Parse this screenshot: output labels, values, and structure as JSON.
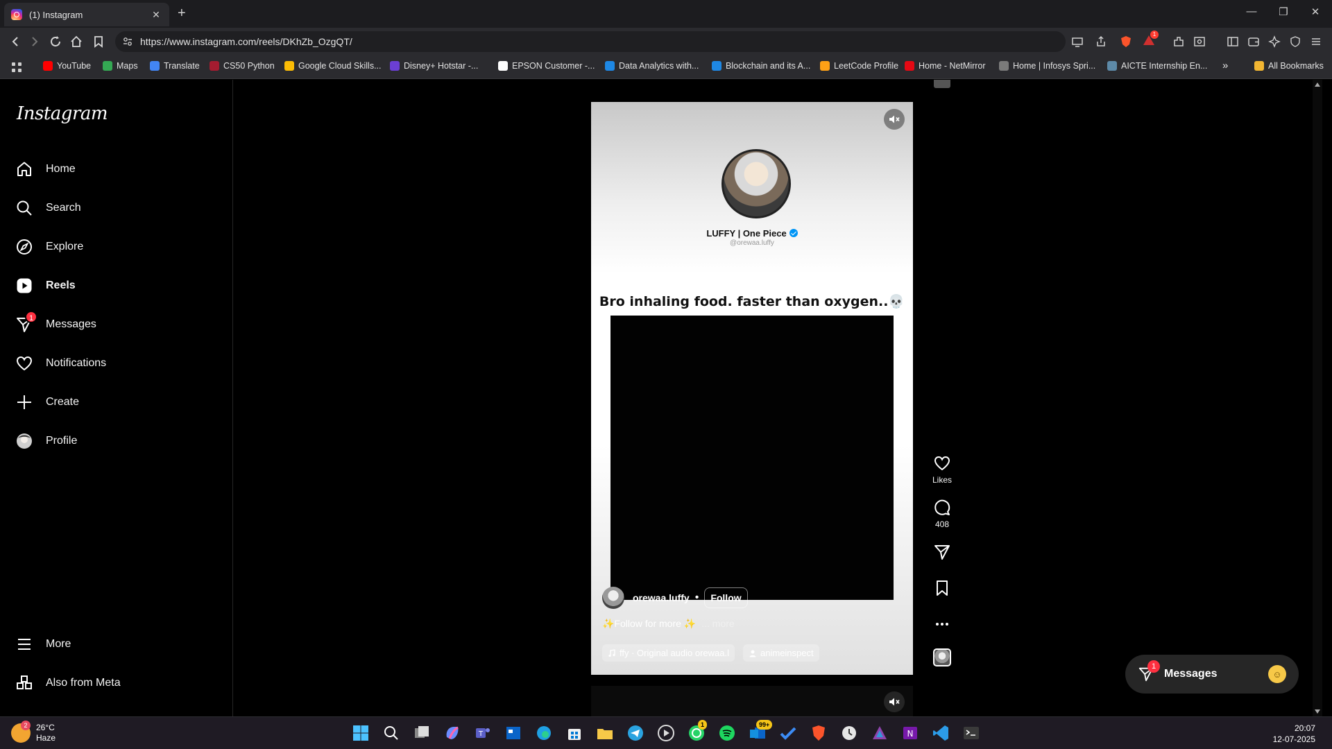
{
  "browser": {
    "tab_title": "(1) Instagram",
    "tab_close": "✕",
    "new_tab": "+",
    "url": "https://www.instagram.com/reels/DKhZb_OzgQT/",
    "window_controls": [
      "—",
      "❐",
      "✕"
    ],
    "bookmarks": [
      {
        "label": "YouTube",
        "color": "#ff0000"
      },
      {
        "label": "Maps",
        "color": "#34a853"
      },
      {
        "label": "Translate",
        "color": "#4285f4"
      },
      {
        "label": "CS50 Python",
        "color": "#a51c30"
      },
      {
        "label": "Google Cloud Skills...",
        "color": "#fbbc05"
      },
      {
        "label": "Disney+ Hotstar -...",
        "color": "#6b3fd4"
      },
      {
        "label": "EPSON Customer -...",
        "color": "#ffffff"
      },
      {
        "label": "Data Analytics with...",
        "color": "#1e88e5"
      },
      {
        "label": "Blockchain and its A...",
        "color": "#1e88e5"
      },
      {
        "label": "LeetCode Profile",
        "color": "#ffa116"
      },
      {
        "label": "Home - NetMirror",
        "color": "#e50914"
      },
      {
        "label": "Home | Infosys Spri...",
        "color": "#7a7a7a"
      },
      {
        "label": "AICTE Internship En...",
        "color": "#5d8aa8"
      }
    ],
    "bookmarks_overflow": "»",
    "all_bookmarks": "All Bookmarks",
    "shield_badge": "1"
  },
  "sidebar": {
    "logo": "Instagram",
    "items": [
      {
        "label": "Home",
        "icon": "home-icon"
      },
      {
        "label": "Search",
        "icon": "search-icon"
      },
      {
        "label": "Explore",
        "icon": "explore-icon"
      },
      {
        "label": "Reels",
        "icon": "reels-icon",
        "active": true
      },
      {
        "label": "Messages",
        "icon": "messenger-icon",
        "badge": "1"
      },
      {
        "label": "Notifications",
        "icon": "heart-icon"
      },
      {
        "label": "Create",
        "icon": "plus-icon"
      },
      {
        "label": "Profile",
        "icon": "avatar-icon"
      }
    ],
    "more": "More",
    "also_from_meta": "Also from Meta"
  },
  "reel": {
    "account_title": "LUFFY | One Piece",
    "account_handle": "@orewaa.luffy",
    "caption_overlay": "Bro inhaling food. faster than oxygen..💀",
    "author": "orewaa.luffy",
    "dot": "•",
    "follow": "Follow",
    "caption": "✨Follow for more ✨",
    "more": "... more",
    "audio": "ffy · Original audio  orewaa.l",
    "tagged_user": "animeinspect",
    "likes_label": "Likes",
    "comments_count": "408"
  },
  "messages_widget": {
    "label": "Messages",
    "badge": "1"
  },
  "taskbar": {
    "temperature": "26°C",
    "condition": "Haze",
    "weather_badge": "2",
    "whatsapp_badge": "1",
    "outlook_badge": "99+",
    "time": "20:07",
    "date": "12-07-2025"
  },
  "colors": {
    "notification_red": "#ff3040",
    "verified_blue": "#0095f6",
    "chrome_bg": "#2b2b2f"
  }
}
